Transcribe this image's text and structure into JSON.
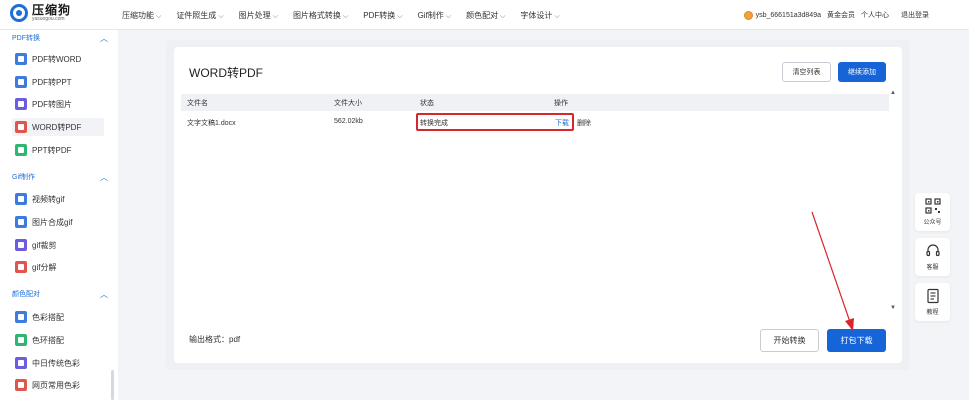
{
  "logo": {
    "name": "压缩狗",
    "sub": "yasuogou.com"
  },
  "nav": {
    "items": [
      {
        "label": "压缩功能"
      },
      {
        "label": "证件照生成"
      },
      {
        "label": "图片处理"
      },
      {
        "label": "图片格式转换"
      },
      {
        "label": "PDF转换"
      },
      {
        "label": "Gif制作"
      },
      {
        "label": "颜色配对"
      },
      {
        "label": "字体设计"
      }
    ],
    "chevron": "⌵"
  },
  "user": {
    "name": "ysb_666151a3d849a",
    "vip": "黄金会员",
    "center": "个人中心",
    "logout": "退出登录"
  },
  "sidebar": {
    "groups": [
      {
        "title": "PDF转换",
        "chevron": "︿",
        "items": [
          {
            "label": "PDF转WORD",
            "color": "#3c7be0"
          },
          {
            "label": "PDF转PPT",
            "color": "#3c7be0"
          },
          {
            "label": "PDF转图片",
            "color": "#6a5de0"
          },
          {
            "label": "WORD转PDF",
            "color": "#e0564f"
          },
          {
            "label": "PPT转PDF",
            "color": "#2fb672"
          }
        ]
      },
      {
        "title": "Gif制作",
        "chevron": "︿",
        "items": [
          {
            "label": "视频转gif",
            "color": "#3c7be0"
          },
          {
            "label": "图片合成gif",
            "color": "#3c7be0"
          },
          {
            "label": "gif裁剪",
            "color": "#6a5de0"
          },
          {
            "label": "gif分解",
            "color": "#e0564f"
          }
        ]
      },
      {
        "title": "颜色配对",
        "chevron": "︿",
        "items": [
          {
            "label": "色彩搭配",
            "color": "#3c7be0"
          },
          {
            "label": "色环搭配",
            "color": "#2fb672"
          },
          {
            "label": "中日传统色彩",
            "color": "#6a5de0"
          },
          {
            "label": "网页常用色彩",
            "color": "#e0564f"
          }
        ]
      }
    ]
  },
  "main": {
    "title": "WORD转PDF",
    "clear_label": "清空列表",
    "add_label": "继续添加",
    "columns": [
      "文件名",
      "文件大小",
      "状态",
      "操作"
    ],
    "rows": [
      {
        "filename": "文字文稿1.docx",
        "size": "562.02kb",
        "status": "转换完成",
        "download": "下载",
        "delete": "删除"
      }
    ],
    "output_format": "输出格式：pdf",
    "start_label": "开始转换",
    "pack_label": "打包下载"
  },
  "float_panel": [
    {
      "label": "公众号",
      "icon": "qr-code-icon"
    },
    {
      "label": "客服",
      "icon": "headset-icon"
    },
    {
      "label": "教程",
      "icon": "document-icon"
    }
  ],
  "colors": {
    "accent": "#1565d8",
    "highlight": "#d9262c"
  }
}
